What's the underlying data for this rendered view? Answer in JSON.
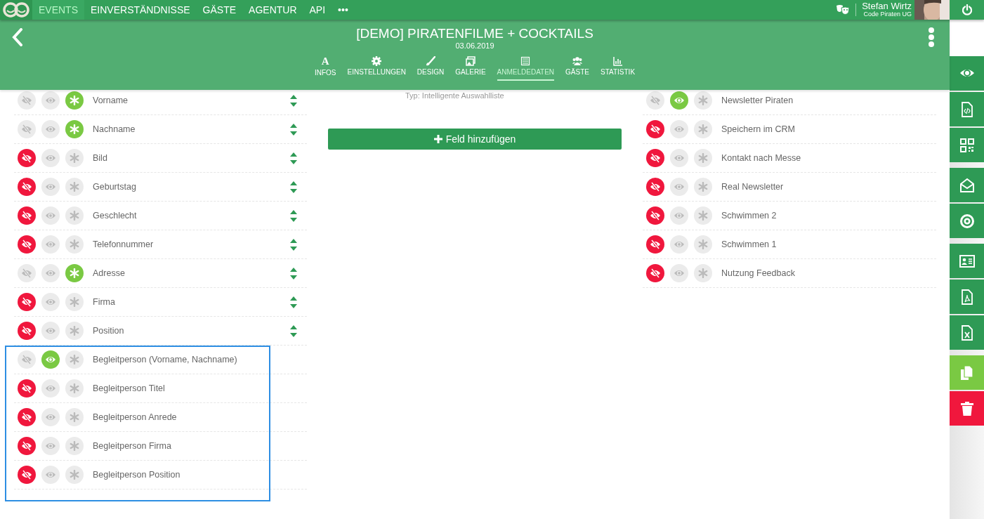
{
  "topbar": {
    "nav": [
      {
        "label": "EVENTS",
        "selected": true
      },
      {
        "label": "EINVERSTÄNDNISSE",
        "selected": false
      },
      {
        "label": "GÄSTE",
        "selected": false
      },
      {
        "label": "AGENTUR",
        "selected": false
      },
      {
        "label": "API",
        "selected": false
      },
      {
        "label": "•••",
        "selected": false
      }
    ],
    "user": {
      "name": "Stefan Wirtz",
      "company": "Code Piraten UG"
    }
  },
  "event": {
    "title": "[DEMO] PIRATENFILME + COCKTAILS",
    "date": "03.06.2019",
    "tabs": [
      {
        "label": "INFOS",
        "glyph": "A",
        "selected": false
      },
      {
        "label": "EINSTELLUNGEN",
        "selected": false
      },
      {
        "label": "DESIGN",
        "selected": false
      },
      {
        "label": "GALERIE",
        "selected": false
      },
      {
        "label": "ANMELDEDATEN",
        "selected": true
      },
      {
        "label": "GÄSTE",
        "selected": false
      },
      {
        "label": "STATISTIK",
        "selected": false
      }
    ]
  },
  "left_fields": [
    {
      "label": "Vorname",
      "hidden": false,
      "visible": false,
      "required": true,
      "movable": true,
      "highlighted": false
    },
    {
      "label": "Nachname",
      "hidden": false,
      "visible": false,
      "required": true,
      "movable": true,
      "highlighted": false
    },
    {
      "label": "Bild",
      "hidden": true,
      "visible": false,
      "required": false,
      "movable": true,
      "highlighted": false
    },
    {
      "label": "Geburtstag",
      "hidden": true,
      "visible": false,
      "required": false,
      "movable": true,
      "highlighted": false
    },
    {
      "label": "Geschlecht",
      "hidden": true,
      "visible": false,
      "required": false,
      "movable": true,
      "highlighted": false
    },
    {
      "label": "Telefonnummer",
      "hidden": true,
      "visible": false,
      "required": false,
      "movable": true,
      "highlighted": false
    },
    {
      "label": "Adresse",
      "hidden": false,
      "visible": false,
      "required": true,
      "movable": true,
      "highlighted": false
    },
    {
      "label": "Firma",
      "hidden": true,
      "visible": false,
      "required": false,
      "movable": true,
      "highlighted": false
    },
    {
      "label": "Position",
      "hidden": true,
      "visible": false,
      "required": false,
      "movable": true,
      "highlighted": false
    },
    {
      "label": "Begleitperson (Vorname, Nachname)",
      "hidden": false,
      "visible": true,
      "required": false,
      "movable": false,
      "highlighted": true
    },
    {
      "label": "Begleitperson Titel",
      "hidden": true,
      "visible": false,
      "required": false,
      "movable": false,
      "highlighted": true
    },
    {
      "label": "Begleitperson Anrede",
      "hidden": true,
      "visible": false,
      "required": false,
      "movable": false,
      "highlighted": true
    },
    {
      "label": "Begleitperson Firma",
      "hidden": true,
      "visible": false,
      "required": false,
      "movable": false,
      "highlighted": true
    },
    {
      "label": "Begleitperson Position",
      "hidden": true,
      "visible": false,
      "required": false,
      "movable": false,
      "highlighted": true
    }
  ],
  "highlight_frame": {
    "shown": true
  },
  "custom_fields": [
    {
      "type": "Typ: Intelligente Auswahlliste"
    }
  ],
  "add_button": "Feld hinzufügen",
  "right_fields": [
    {
      "label": "Newsletter Piraten",
      "hidden": false,
      "visible": true,
      "required": false
    },
    {
      "label": "Speichern im CRM",
      "hidden": true,
      "visible": false,
      "required": false
    },
    {
      "label": "Kontakt nach Messe",
      "hidden": true,
      "visible": false,
      "required": false
    },
    {
      "label": "Real Newsletter",
      "hidden": true,
      "visible": false,
      "required": false
    },
    {
      "label": "Schwimmen 2",
      "hidden": true,
      "visible": false,
      "required": false
    },
    {
      "label": "Schwimmen 1",
      "hidden": true,
      "visible": false,
      "required": false
    },
    {
      "label": "Nutzung Feedback",
      "hidden": true,
      "visible": false,
      "required": false
    }
  ],
  "sidebar_groups": [
    {
      "actions": [
        {
          "color": "#2e9a55"
        },
        {
          "color": "#2e9a55"
        },
        {
          "color": "#2e9a55"
        }
      ]
    },
    {
      "actions": [
        {
          "color": "#2e9a55"
        },
        {
          "color": "#2e9a55"
        }
      ]
    },
    {
      "actions": [
        {
          "color": "#2e9a55"
        },
        {
          "color": "#2e9a55"
        },
        {
          "color": "#2e9a55"
        }
      ]
    },
    {
      "actions": [
        {
          "color": "#7ac943"
        },
        {
          "color": "#f0173d"
        }
      ]
    }
  ]
}
